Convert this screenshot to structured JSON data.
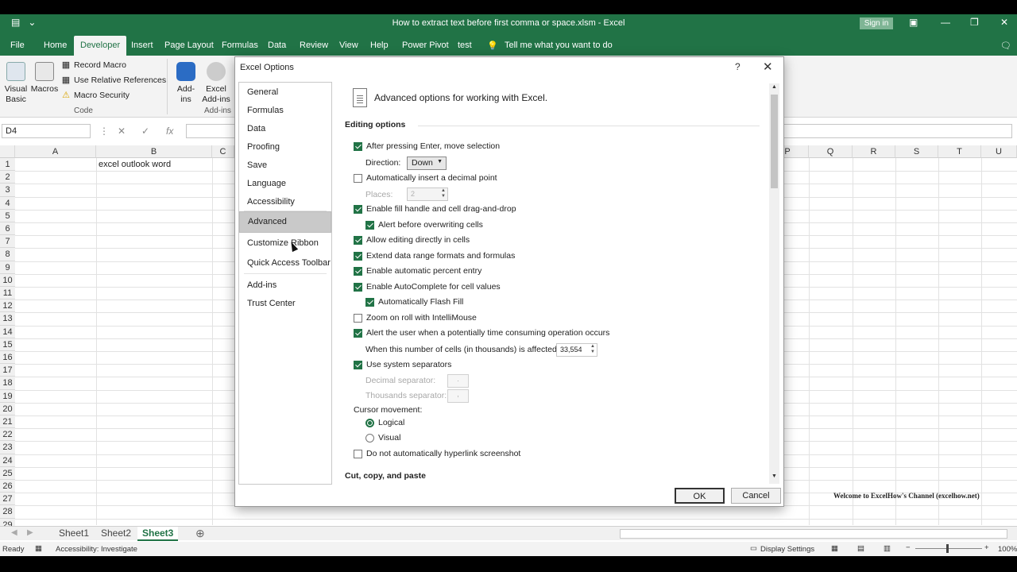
{
  "window": {
    "title": "How to extract text before first comma or space.xlsm  -  Excel",
    "signin": "Sign in"
  },
  "tabs": [
    "File",
    "Home",
    "Developer",
    "Insert",
    "Page Layout",
    "Formulas",
    "Data",
    "Review",
    "View",
    "Help",
    "Power Pivot",
    "test"
  ],
  "active_tab": "Developer",
  "tell_me": "Tell me what you want to do",
  "ribbon": {
    "visual_basic": "Visual Basic",
    "macros": "Macros",
    "record_macro": "Record Macro",
    "relative_refs": "Use Relative References",
    "macro_security": "Macro Security",
    "code_group": "Code",
    "addins": "Add-ins",
    "excel_addins": "Excel Add-ins",
    "addins_group": "Add-ins"
  },
  "namebox": "D4",
  "fx": "fx",
  "columns": [
    "A",
    "B",
    "C",
    "P",
    "Q",
    "R",
    "S",
    "T",
    "U"
  ],
  "cells": {
    "B1": "excel outlook word"
  },
  "watermark": "Welcome to ExcelHow's  Channel (excelhow.net)",
  "sheets": [
    "Sheet1",
    "Sheet2",
    "Sheet3"
  ],
  "active_sheet": "Sheet3",
  "status": {
    "ready": "Ready",
    "accessibility": "Accessibility: Investigate",
    "display": "Display Settings",
    "zoom": "100%"
  },
  "dialog": {
    "title": "Excel Options",
    "help": "?",
    "nav": [
      "General",
      "Formulas",
      "Data",
      "Proofing",
      "Save",
      "Language",
      "Accessibility",
      "Advanced",
      "Customize Ribbon",
      "Quick Access Toolbar",
      "Add-ins",
      "Trust Center"
    ],
    "selected_nav": "Advanced",
    "heading": "Advanced options for working with Excel.",
    "section_editing": "Editing options",
    "section_cut": "Cut, copy, and paste",
    "options": {
      "after_enter": "After pressing Enter, move selection",
      "direction_label": "Direction:",
      "direction_value": "Down",
      "auto_decimal": "Automatically insert a decimal point",
      "places_label": "Places:",
      "places_value": "2",
      "fill_handle": "Enable fill handle and cell drag-and-drop",
      "alert_overwrite": "Alert before overwriting cells",
      "edit_in_cells": "Allow editing directly in cells",
      "extend_formats": "Extend data range formats and formulas",
      "auto_percent": "Enable automatic percent entry",
      "autocomplete": "Enable AutoComplete for cell values",
      "flash_fill": "Automatically Flash Fill",
      "zoom_roll": "Zoom on roll with IntelliMouse",
      "alert_time": "Alert the user when a potentially time consuming operation occurs",
      "cells_affected_label": "When this number of cells (in thousands) is affected:",
      "cells_affected_value": "33,554",
      "system_sep": "Use system separators",
      "decimal_sep": "Decimal separator:",
      "decimal_sep_value": ".",
      "thousands_sep": "Thousands separator:",
      "thousands_sep_value": ",",
      "cursor_movement": "Cursor movement:",
      "logical": "Logical",
      "visual": "Visual",
      "no_hyperlink": "Do not automatically hyperlink screenshot"
    },
    "ok": "OK",
    "cancel": "Cancel"
  }
}
